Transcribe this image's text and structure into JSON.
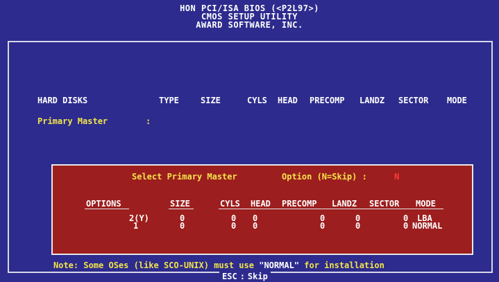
{
  "header": {
    "line1": "HON PCI/ISA BIOS (<P2L97>)",
    "line2": "CMOS SETUP UTILITY",
    "line3": "AWARD SOFTWARE, INC."
  },
  "table": {
    "columns": [
      "HARD DISKS",
      "TYPE",
      "SIZE",
      "CYLS",
      "HEAD",
      "PRECOMP",
      "LANDZ",
      "SECTOR",
      "MODE"
    ],
    "rows": [
      {
        "label": "Primary Master",
        "separator": ":"
      }
    ]
  },
  "dialog": {
    "title": "Select Primary Master",
    "option_prompt": "Option (N=Skip) :",
    "option_value": "N",
    "columns": [
      "OPTIONS",
      "SIZE",
      "CYLS",
      "HEAD",
      "PRECOMP",
      "LANDZ",
      "SECTOR",
      "MODE"
    ],
    "rows": [
      {
        "option": "2(Y)",
        "size": "0",
        "cyls": "0",
        "head": "0",
        "precomp": "0",
        "landz": "0",
        "sector": "0",
        "mode": "LBA"
      },
      {
        "option": "1",
        "size": "0",
        "cyls": "0",
        "head": "0",
        "precomp": "0",
        "landz": "0",
        "sector": "0",
        "mode": "NORMAL"
      }
    ]
  },
  "footer": {
    "note_prefix": "Note: Some OSes (like SCO-UNIX) must use ",
    "note_quote": "\"NORMAL\"",
    "note_suffix": " for installation",
    "esc_key": "ESC",
    "esc_action": "Skip"
  },
  "colors": {
    "background": "#2d2b8d",
    "dialog": "#9d1e1e",
    "highlight": "#f2e44a"
  }
}
